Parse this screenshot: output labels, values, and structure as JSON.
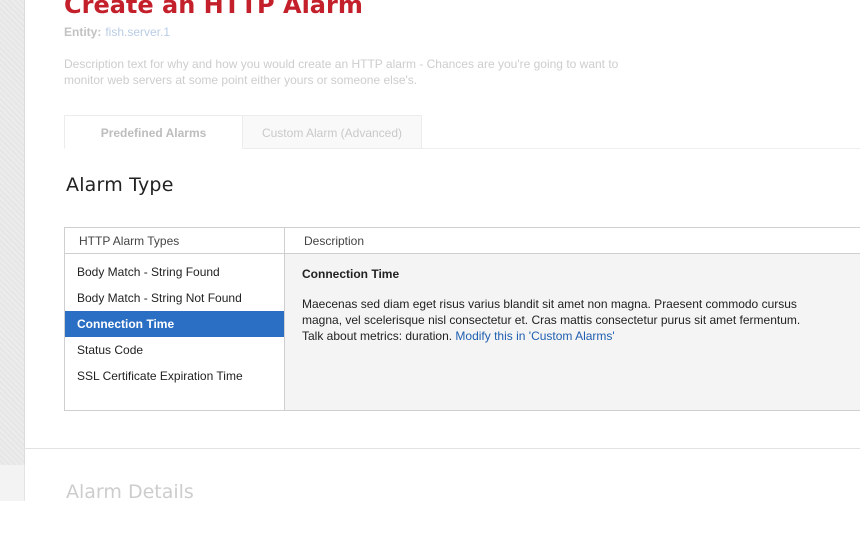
{
  "page": {
    "title": "Create an HTTP Alarm",
    "entity_label": "Entity:",
    "entity_value": "fish.server.1",
    "description": "Description text for why and how you would create an HTTP alarm - Chances are you're going to want to monitor web servers at some point either yours or someone else's."
  },
  "tabs": [
    {
      "label": "Predefined Alarms",
      "active": true
    },
    {
      "label": "Custom Alarm (Advanced)",
      "active": false
    }
  ],
  "alarm_type": {
    "heading": "Alarm Type",
    "columns": {
      "types": "HTTP Alarm Types",
      "description": "Description"
    },
    "types": [
      {
        "label": "Body Match - String Found",
        "selected": false
      },
      {
        "label": "Body Match - String Not Found",
        "selected": false
      },
      {
        "label": "Connection Time",
        "selected": true
      },
      {
        "label": "Status Code",
        "selected": false
      },
      {
        "label": "SSL Certificate Expiration Time",
        "selected": false
      }
    ],
    "detail": {
      "title": "Connection Time",
      "body": "Maecenas sed diam eget risus varius blandit sit amet non magna. Praesent commodo cursus magna, vel scelerisque nisl consectetur et. Cras mattis consectetur purus sit amet fermentum. Talk about metrics: duration.",
      "link": "Modify this in 'Custom Alarms'"
    }
  },
  "alarm_details": {
    "heading": "Alarm Details"
  },
  "colors": {
    "title_red": "#c4202b",
    "selection_blue": "#2a6fc4",
    "link_blue": "#1f5fb0"
  }
}
